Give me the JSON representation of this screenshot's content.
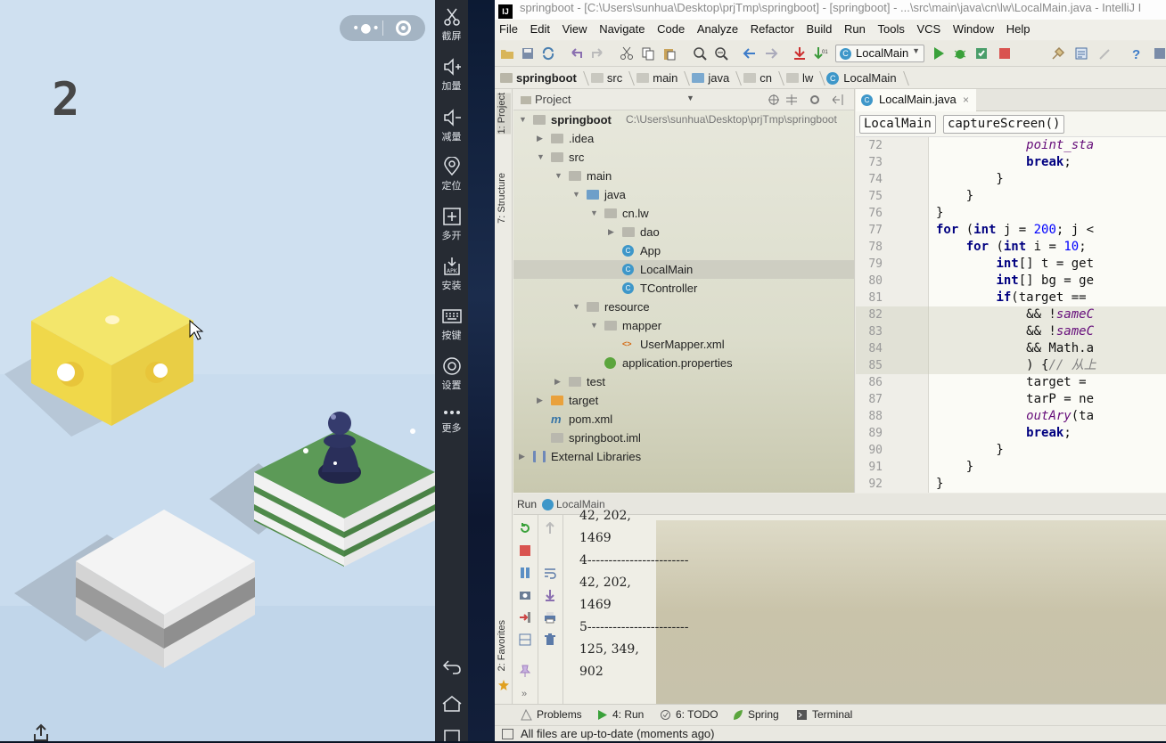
{
  "game": {
    "score": "2"
  },
  "side_toolbar": {
    "items": [
      {
        "label": "截屏",
        "icon": "scissors-icon"
      },
      {
        "label": "加量",
        "icon": "volume-up-icon"
      },
      {
        "label": "减量",
        "icon": "volume-down-icon"
      },
      {
        "label": "定位",
        "icon": "location-pin-icon"
      },
      {
        "label": "多开",
        "icon": "multi-instance-icon"
      },
      {
        "label": "安装",
        "icon": "apk-install-icon"
      },
      {
        "label": "按键",
        "icon": "keyboard-icon"
      },
      {
        "label": "设置",
        "icon": "settings-gear-icon"
      },
      {
        "label": "更多",
        "icon": "more-dots-icon"
      }
    ],
    "nav": [
      "back-icon",
      "home-icon",
      "recent-apps-icon"
    ]
  },
  "ide": {
    "title": "springboot - [C:\\Users\\sunhua\\Desktop\\prjTmp\\springboot] - [springboot] - ...\\src\\main\\java\\cn\\lw\\LocalMain.java - IntelliJ I",
    "logo": "IJ",
    "menu": [
      "File",
      "Edit",
      "View",
      "Navigate",
      "Code",
      "Analyze",
      "Refactor",
      "Build",
      "Run",
      "Tools",
      "VCS",
      "Window",
      "Help"
    ],
    "run_config": "LocalMain",
    "breadcrumbs": [
      "springboot",
      "src",
      "main",
      "java",
      "cn",
      "lw",
      "LocalMain"
    ],
    "left_tabs": [
      "1: Project",
      "7: Structure",
      "2: Favorites"
    ],
    "project": {
      "header": "Project",
      "rows": [
        {
          "label": "springboot",
          "path": "C:\\Users\\sunhua\\Desktop\\prjTmp\\springboot",
          "depth": 0,
          "icon": "folder",
          "arrow": "down",
          "bold": true
        },
        {
          "label": ".idea",
          "depth": 1,
          "icon": "folder",
          "arrow": "right"
        },
        {
          "label": "src",
          "depth": 1,
          "icon": "folder",
          "arrow": "down"
        },
        {
          "label": "main",
          "depth": 2,
          "icon": "folder",
          "arrow": "down"
        },
        {
          "label": "java",
          "depth": 3,
          "icon": "folder-blue",
          "arrow": "down"
        },
        {
          "label": "cn.lw",
          "depth": 4,
          "icon": "folder",
          "arrow": "down"
        },
        {
          "label": "dao",
          "depth": 5,
          "icon": "folder",
          "arrow": "right"
        },
        {
          "label": "App",
          "depth": 5,
          "icon": "class",
          "arrow": ""
        },
        {
          "label": "LocalMain",
          "depth": 5,
          "icon": "class",
          "arrow": "",
          "selected": true
        },
        {
          "label": "TController",
          "depth": 5,
          "icon": "class",
          "arrow": ""
        },
        {
          "label": "resource",
          "depth": 3,
          "icon": "folder",
          "arrow": "down"
        },
        {
          "label": "mapper",
          "depth": 4,
          "icon": "folder",
          "arrow": "down"
        },
        {
          "label": "UserMapper.xml",
          "depth": 5,
          "icon": "xml",
          "arrow": ""
        },
        {
          "label": "application.properties",
          "depth": 4,
          "icon": "properties",
          "arrow": ""
        },
        {
          "label": "test",
          "depth": 2,
          "icon": "folder",
          "arrow": "right"
        },
        {
          "label": "target",
          "depth": 1,
          "icon": "folder-orange",
          "arrow": "right"
        },
        {
          "label": "pom.xml",
          "depth": 1,
          "icon": "maven",
          "arrow": ""
        },
        {
          "label": "springboot.iml",
          "depth": 1,
          "icon": "file",
          "arrow": ""
        },
        {
          "label": "External Libraries",
          "depth": 0,
          "icon": "library",
          "arrow": "right"
        }
      ]
    },
    "editor": {
      "tab": "LocalMain.java",
      "crumbs": [
        "LocalMain",
        "captureScreen()"
      ],
      "lines": [
        {
          "n": "72",
          "code": "            point_sta"
        },
        {
          "n": "73",
          "code": "            break;"
        },
        {
          "n": "74",
          "code": "        }"
        },
        {
          "n": "75",
          "code": "    }"
        },
        {
          "n": "76",
          "code": "}"
        },
        {
          "n": "77",
          "code": "for (int j = 200; j <"
        },
        {
          "n": "78",
          "code": "    for (int i = 10;"
        },
        {
          "n": "79",
          "code": "        int[] t = get"
        },
        {
          "n": "80",
          "code": "        int[] bg = ge"
        },
        {
          "n": "81",
          "code": "        if(target =="
        },
        {
          "n": "82",
          "code": "            && !sameC"
        },
        {
          "n": "83",
          "code": "            && !sameC"
        },
        {
          "n": "84",
          "code": "            && Math.a"
        },
        {
          "n": "85",
          "code": "            ) {// 从上"
        },
        {
          "n": "86",
          "code": "            target ="
        },
        {
          "n": "87",
          "code": "            tarP = ne"
        },
        {
          "n": "88",
          "code": "            outAry(ta"
        },
        {
          "n": "89",
          "code": "            break;"
        },
        {
          "n": "90",
          "code": "        }"
        },
        {
          "n": "91",
          "code": "    }"
        },
        {
          "n": "92",
          "code": "}"
        }
      ]
    },
    "run": {
      "label": "Run",
      "config": "LocalMain",
      "output": [
        "42, 202,",
        "1469",
        "4------------------------",
        "42, 202,",
        "1469",
        "5------------------------",
        "125, 349,",
        "902"
      ]
    },
    "bottom_tabs": [
      {
        "label": "Problems",
        "icon": "problems-icon"
      },
      {
        "label": "4: Run",
        "icon": "run-icon"
      },
      {
        "label": "6: TODO",
        "icon": "todo-icon"
      },
      {
        "label": "Spring",
        "icon": "spring-icon"
      },
      {
        "label": "Terminal",
        "icon": "terminal-icon"
      }
    ],
    "status": "All files are up-to-date (moments ago)"
  }
}
